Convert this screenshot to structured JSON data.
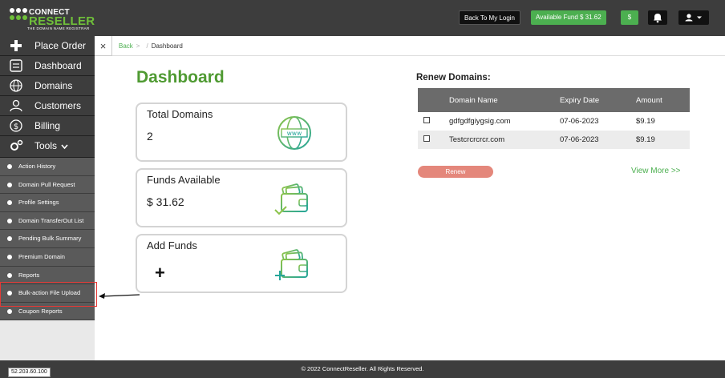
{
  "brand": {
    "line1": "CONNECT",
    "line2": "RESELLER",
    "tagline": "THE DOMAIN NAME REGISTRAR"
  },
  "header": {
    "back_to_login": "Back To My Login",
    "available_fund": "Available Fund  $ 31.62",
    "dollar_label": "$"
  },
  "sidebar": {
    "main": [
      "Place Order",
      "Dashboard",
      "Domains",
      "Customers",
      "Billing",
      "Tools"
    ],
    "sub": [
      "Action History",
      "Domain Pull Request",
      "Profile Settings",
      "Domain TransferOut List",
      "Pending Bulk Summary",
      "Premium Domain",
      "Reports",
      "Bulk-action File Upload",
      "Coupon Reports"
    ]
  },
  "breadcrumb": {
    "close": "×",
    "back": "Back",
    "sep1": ">",
    "sep2": "/",
    "current": "Dashboard"
  },
  "main": {
    "title": "Dashboard",
    "cards": [
      {
        "title": "Total Domains",
        "value": "2"
      },
      {
        "title": "Funds Available",
        "value": "$ 31.62"
      },
      {
        "title": "Add Funds",
        "value": "+"
      }
    ]
  },
  "renew": {
    "title": "Renew Domains:",
    "columns": [
      "Domain Name",
      "Expiry Date",
      "Amount"
    ],
    "rows": [
      {
        "domain": "gdfgdfgiygsig.com",
        "expiry": "07-06-2023",
        "amount": "$9.19"
      },
      {
        "domain": "Testcrcrcrcr.com",
        "expiry": "07-06-2023",
        "amount": "$9.19"
      }
    ],
    "renew_button": "Renew",
    "view_more": "View More >>"
  },
  "footer": {
    "copyright": "© 2022 ConnectReseller. All Rights Reserved.",
    "ip": "52.203.60.100"
  },
  "colors": {
    "accent": "#4caf50",
    "title_green": "#4f9a32",
    "dark": "#3d3d3d",
    "highlight": "#e53935"
  }
}
